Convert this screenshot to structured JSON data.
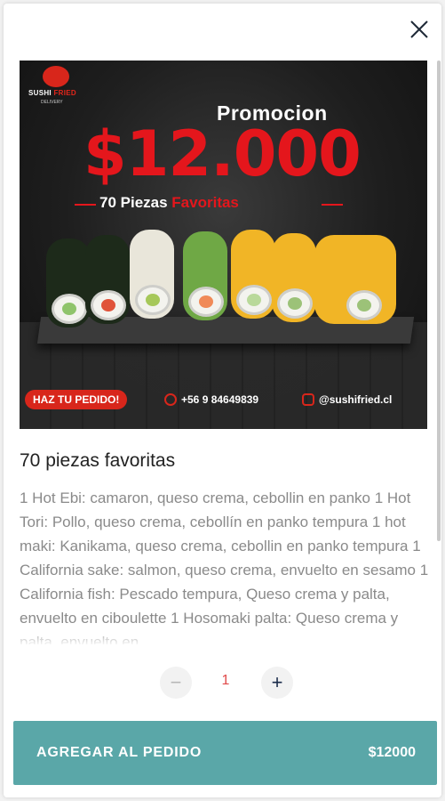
{
  "banner": {
    "logo_name": "SUSHI",
    "logo_name_accent": "FRIED",
    "logo_sub": "DELIVERY",
    "promo_word": "Promocion",
    "promo_price": "$12.000",
    "promo_pieces": "70 Piezas",
    "promo_pieces_accent": "Favoritas",
    "cta": "HAZ TU PEDIDO!",
    "phone": "+56 9 84649839",
    "instagram": "@sushifried.cl"
  },
  "product": {
    "title": "70 piezas favoritas",
    "description": "1 Hot Ebi: camaron, queso crema, cebollin en panko 1 Hot Tori: Pollo, queso crema, cebollín en panko tempura 1 hot maki: Kanikama, queso crema, cebollin en panko tempura 1 California sake: salmon, queso crema, envuelto en sesamo 1 California fish: Pescado tempura, Queso crema y palta, envuelto en ciboulette 1 Hosomaki palta: Queso crema y palta, envuelto en"
  },
  "quantity": {
    "minus_symbol": "−",
    "value": "1",
    "plus_symbol": "+"
  },
  "add_button": {
    "label": "AGREGAR AL PEDIDO",
    "price": "$12000"
  },
  "colors": {
    "accent": "#5aa7a8",
    "brand_red": "#e4161c"
  },
  "icons": {
    "close": "close-icon",
    "minus": "minus-icon",
    "plus": "plus-icon"
  }
}
